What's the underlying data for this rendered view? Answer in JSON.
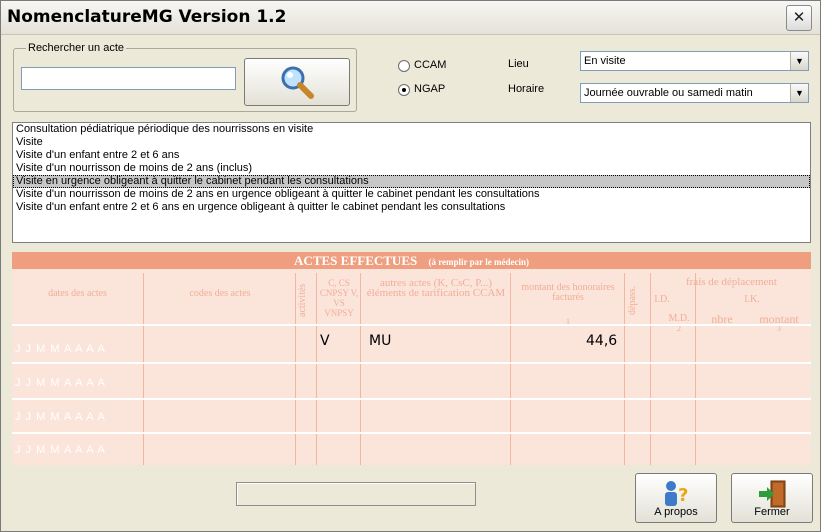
{
  "window": {
    "title": "NomenclatureMG Version 1.2",
    "close_glyph": "✕"
  },
  "search": {
    "legend": "Rechercher un acte",
    "value": "",
    "icon": "magnifier-icon"
  },
  "mode": {
    "options": [
      "CCAM",
      "NGAP"
    ],
    "selected": "NGAP"
  },
  "lieu": {
    "label": "Lieu",
    "value": "En visite"
  },
  "horaire": {
    "label": "Horaire",
    "value": "Journée ouvrable ou samedi matin"
  },
  "acts": {
    "items": [
      "Consultation pédiatrique périodique des nourrissons en visite",
      "Visite",
      "Visite d'un enfant entre 2 et 6 ans",
      "Visite d'un nourrisson de moins de 2 ans (inclus)",
      "Visite en urgence obligeant à quitter le cabinet pendant les consultations",
      "Visite d'un nourrisson de moins de 2 ans en urgence obligeant à quitter le cabinet pendant les consultations",
      "Visite d'un enfant entre 2 et 6 ans en urgence obligeant à quitter le cabinet pendant les consultations"
    ],
    "selected_index": 4
  },
  "form": {
    "title": "ACTES EFFECTUES",
    "subtitle": "(à remplir par le médecin)",
    "headers": {
      "dates": "dates des actes",
      "codes": "codes des actes",
      "activites": "activités",
      "codes_ngap": "C, CS CNPSY V, VS VNPSY",
      "autres": "autres actes (K, CsC, P...) éléments de tarification CCAM",
      "montant": "montant des honoraires facturés",
      "montant_num": "1",
      "depass": "dépass.",
      "frais": "frais de déplacement",
      "id": "I.D.",
      "md": "M.D.",
      "md_num": "2",
      "ik": "I.K.",
      "nbre": "nbre",
      "montant_ik": "montant",
      "montant_ik_num": "3"
    },
    "row_date_label": "J J M M A A A A",
    "entry": {
      "code": "V",
      "autres": "MU",
      "montant": "44,6"
    }
  },
  "buttons": {
    "apropos": {
      "label": "A propos",
      "icon": "help-person-icon"
    },
    "fermer": {
      "label": "Fermer",
      "icon": "exit-door-icon"
    }
  },
  "colors": {
    "form_bg": "#fbe4da",
    "form_header": "#ef9f80",
    "form_lines": "#f1ae98"
  }
}
